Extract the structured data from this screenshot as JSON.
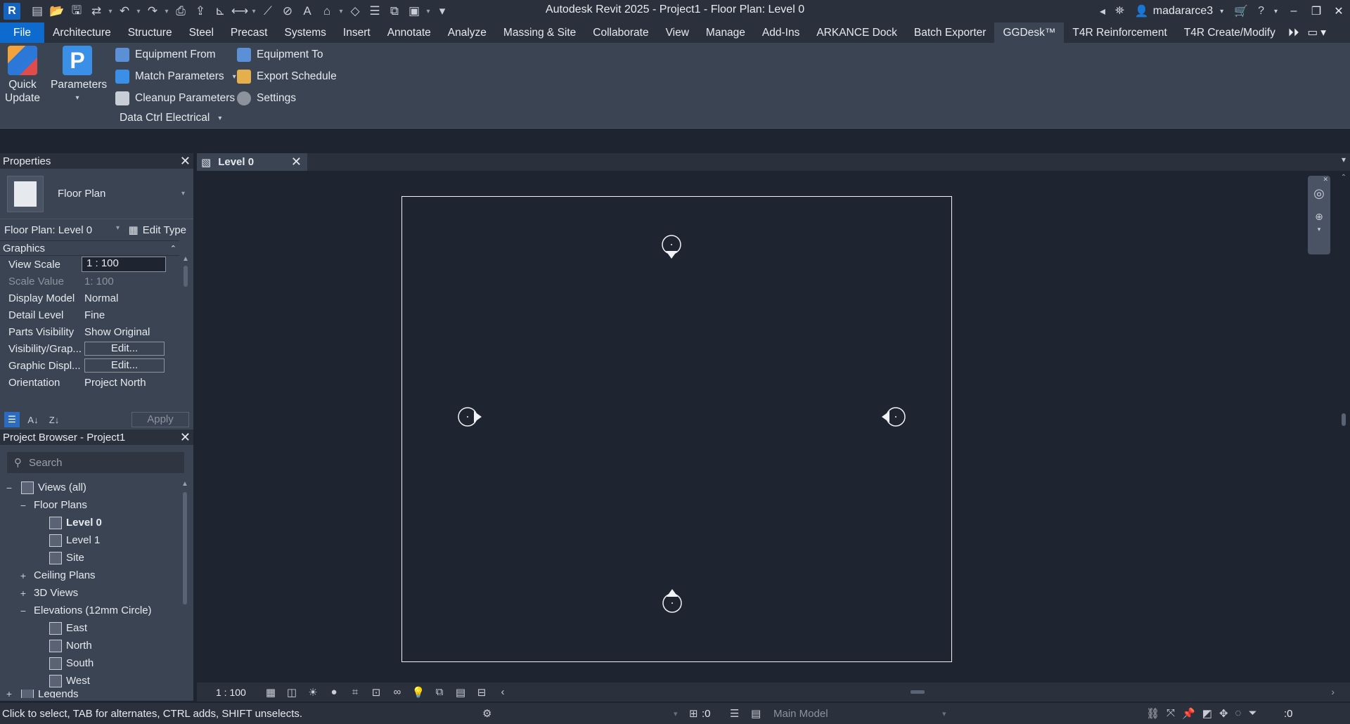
{
  "window": {
    "title": "Autodesk Revit 2025 - Project1 - Floor Plan: Level 0",
    "app_icon_letter": "R",
    "user": "madararce3"
  },
  "quick_access": [
    "file-new-icon",
    "open-icon",
    "save-icon",
    "sync-icon",
    "undo-icon",
    "redo-icon",
    "print-icon",
    "export-icon",
    "measure-icon",
    "dimension-icon",
    "tag-icon",
    "text-icon",
    "3d-view-icon",
    "section-icon",
    "thin-lines-icon",
    "close-hidden-icon",
    "switch-windows-icon",
    "customize-icon"
  ],
  "menu": {
    "tabs": [
      "File",
      "Architecture",
      "Structure",
      "Steel",
      "Precast",
      "Systems",
      "Insert",
      "Annotate",
      "Analyze",
      "Massing & Site",
      "Collaborate",
      "View",
      "Manage",
      "Add-Ins",
      "ARKANCE Dock",
      "Batch Exporter",
      "GGDesk™",
      "T4R Reinforcement",
      "T4R Create/Modify"
    ],
    "active_tab": "GGDesk™"
  },
  "ribbon": {
    "quick_update_label_1": "Quick",
    "quick_update_label_2": "Update",
    "parameters_label": "Parameters",
    "equipment_from": "Equipment From",
    "equipment_to": "Equipment To",
    "match_parameters": "Match Parameters",
    "export_schedule": "Export Schedule",
    "cleanup_parameters": "Cleanup Parameters",
    "settings": "Settings",
    "data_ctrl": "Data Ctrl Electrical",
    "colors": {
      "quick_update": "#2b78d8",
      "parameters": "#3a8fe6",
      "accent": "#0d6bd0"
    }
  },
  "properties": {
    "title": "Properties",
    "type_name": "Floor Plan",
    "instance": "Floor Plan: Level 0",
    "edit_type": "Edit Type",
    "group": "Graphics",
    "rows": [
      {
        "name": "View Scale",
        "value": "1 : 100"
      },
      {
        "name": "Scale Value",
        "value": "1:  100"
      },
      {
        "name": "Display Model",
        "value": "Normal"
      },
      {
        "name": "Detail Level",
        "value": "Fine"
      },
      {
        "name": "Parts Visibility",
        "value": "Show Original"
      },
      {
        "name": "Visibility/Grap...",
        "value": "Edit..."
      },
      {
        "name": "Graphic Displ...",
        "value": "Edit..."
      },
      {
        "name": "Orientation",
        "value": "Project North"
      }
    ],
    "apply": "Apply"
  },
  "browser": {
    "title": "Project Browser - Project1",
    "search_placeholder": "Search",
    "tree": [
      {
        "label": "Views (all)",
        "toggle": "−",
        "level": 0,
        "bold": false
      },
      {
        "label": "Floor Plans",
        "toggle": "−",
        "level": 1
      },
      {
        "label": "Level 0",
        "level": 2,
        "bold": true
      },
      {
        "label": "Level 1",
        "level": 2
      },
      {
        "label": "Site",
        "level": 2
      },
      {
        "label": "Ceiling Plans",
        "toggle": "+",
        "level": 1
      },
      {
        "label": "3D Views",
        "toggle": "+",
        "level": 1
      },
      {
        "label": "Elevations (12mm Circle)",
        "toggle": "−",
        "level": 1
      },
      {
        "label": "East",
        "level": 2
      },
      {
        "label": "North",
        "level": 2
      },
      {
        "label": "South",
        "level": 2
      },
      {
        "label": "West",
        "level": 2
      },
      {
        "label": "Legends",
        "toggle": "+",
        "level": 0
      }
    ]
  },
  "view": {
    "tab_label": "Level 0",
    "scale": "1 : 100"
  },
  "status": {
    "hint": "Click to select, TAB for alternates, CTRL adds, SHIFT unselects.",
    "worksets": ":0",
    "model": "Main Model",
    "filter_count": ":0"
  }
}
